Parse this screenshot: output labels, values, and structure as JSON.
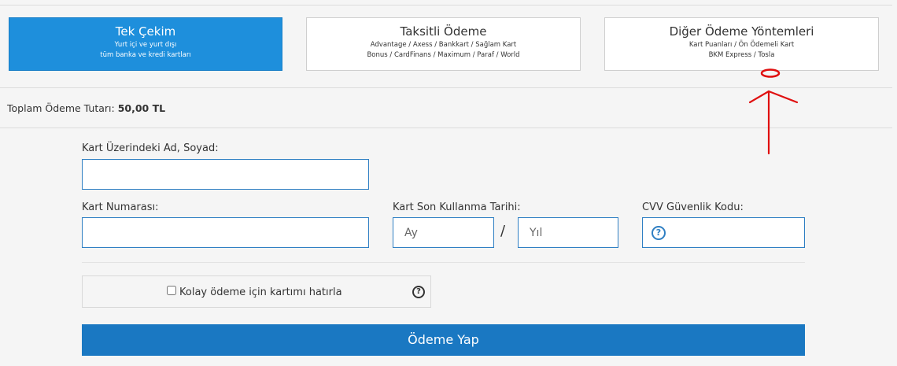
{
  "tabs": [
    {
      "title": "Tek Çekim",
      "sub1": "Yurt içi ve yurt dışı",
      "sub2": "tüm banka ve kredi kartları"
    },
    {
      "title": "Taksitli Ödeme",
      "sub1": "Advantage / Axess / Bankkart / Sağlam Kart",
      "sub2": "Bonus / CardFinans / Maximum / Paraf / World"
    },
    {
      "title": "Diğer Ödeme Yöntemleri",
      "sub1": "Kart Puanları / Ön Ödemeli Kart",
      "sub2": "BKM Express / Tosla"
    }
  ],
  "total": {
    "label": "Toplam Ödeme Tutarı:",
    "amount": "50,00 TL"
  },
  "form": {
    "name_label": "Kart Üzerindeki Ad, Soyad:",
    "name_value": "",
    "number_label": "Kart Numarası:",
    "number_value": "",
    "expiry_label": "Kart Son Kullanma Tarihi:",
    "month_placeholder": "Ay",
    "year_placeholder": "Yıl",
    "expiry_separator": "/",
    "cvv_label": "CVV Güvenlik Kodu:",
    "cvv_value": "",
    "remember_label": "Kolay ödeme için kartımı hatırla",
    "pay_label": "Ödeme Yap"
  },
  "icons": {
    "help": "question-circle-icon"
  },
  "colors": {
    "accent": "#1e8fdc",
    "button": "#1a78c2",
    "annotation": "#e01010"
  }
}
